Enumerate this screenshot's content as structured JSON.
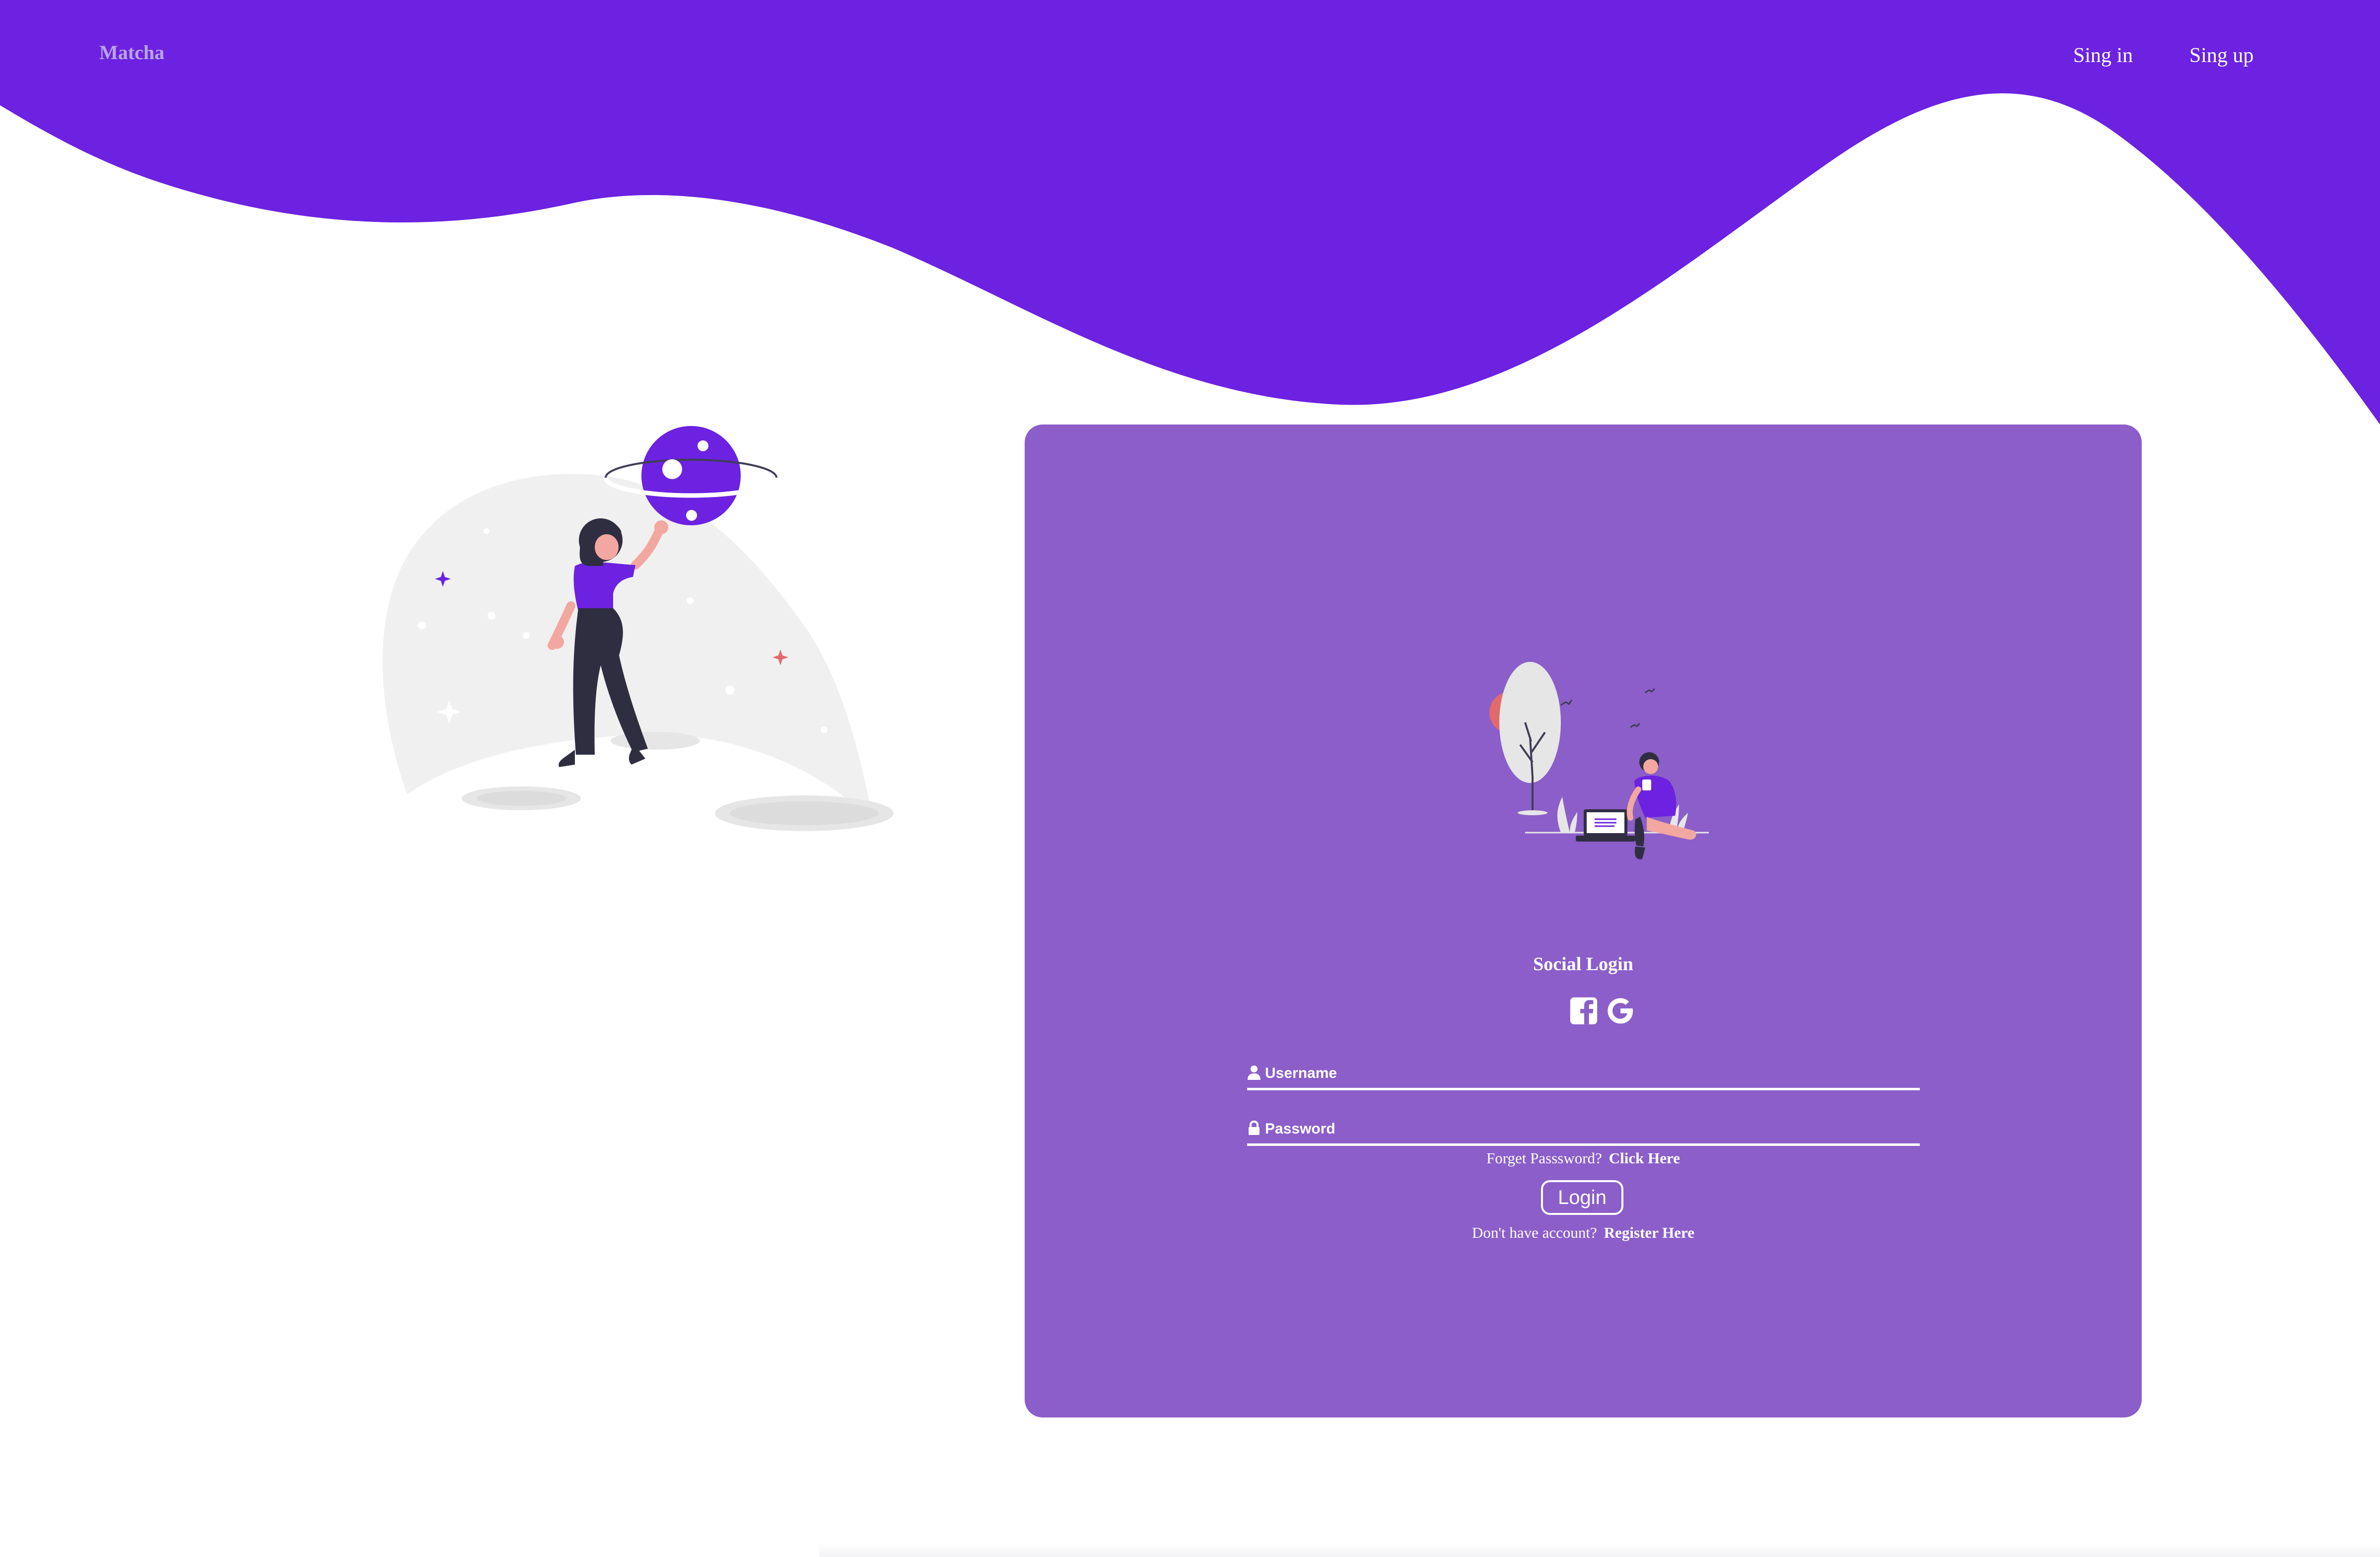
{
  "header": {
    "brand": "Matcha",
    "nav": {
      "signin_label": "Sing in",
      "signup_label": "Sing up"
    }
  },
  "login_card": {
    "social_title": "Social Login",
    "social_icons": [
      "facebook-icon",
      "google-icon"
    ],
    "username": {
      "placeholder": "Username",
      "value": "",
      "icon": "user-icon"
    },
    "password": {
      "placeholder": "Password",
      "value": "",
      "icon": "lock-icon"
    },
    "forgot": {
      "text": "Forget Passsword?",
      "link": "Click Here"
    },
    "login_label": "Login",
    "register": {
      "text": "Don't have account?",
      "link": "Register Here"
    }
  },
  "colors": {
    "header_purple": "#6c22e0",
    "card_purple": "#8b5ec9",
    "brand_text": "#b8a5e6",
    "white": "#ffffff"
  }
}
